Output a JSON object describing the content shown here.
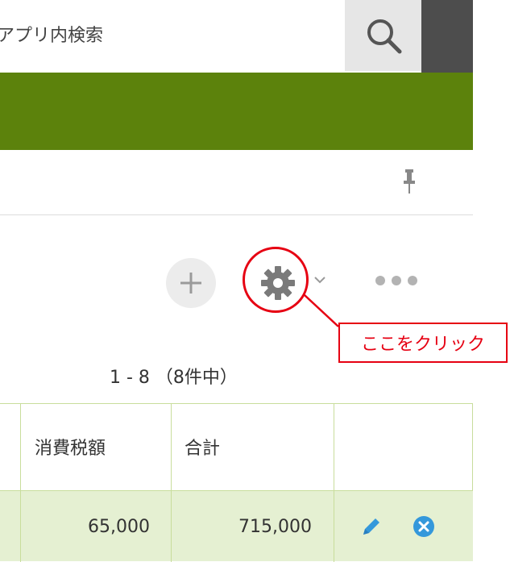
{
  "search": {
    "placeholder": "アプリ内検索"
  },
  "toolbar": {
    "add_icon": "plus-icon",
    "settings_icon": "gear-icon",
    "more_icon": "more-horizontal-icon"
  },
  "annotation": {
    "callout_text": "ここをクリック",
    "color": "#e60012"
  },
  "pagination": {
    "text": "1 - 8 （8件中）"
  },
  "table": {
    "columns": [
      "消費税額",
      "合計"
    ],
    "rows": [
      {
        "tax": "65,000",
        "total": "715,000",
        "actions": [
          "edit-icon",
          "delete-icon"
        ]
      }
    ]
  },
  "colors": {
    "brand_band": "#5c820c",
    "row_highlight": "#e5f0d2",
    "table_border": "#c8dd9c",
    "accent_blue": "#3498db"
  }
}
